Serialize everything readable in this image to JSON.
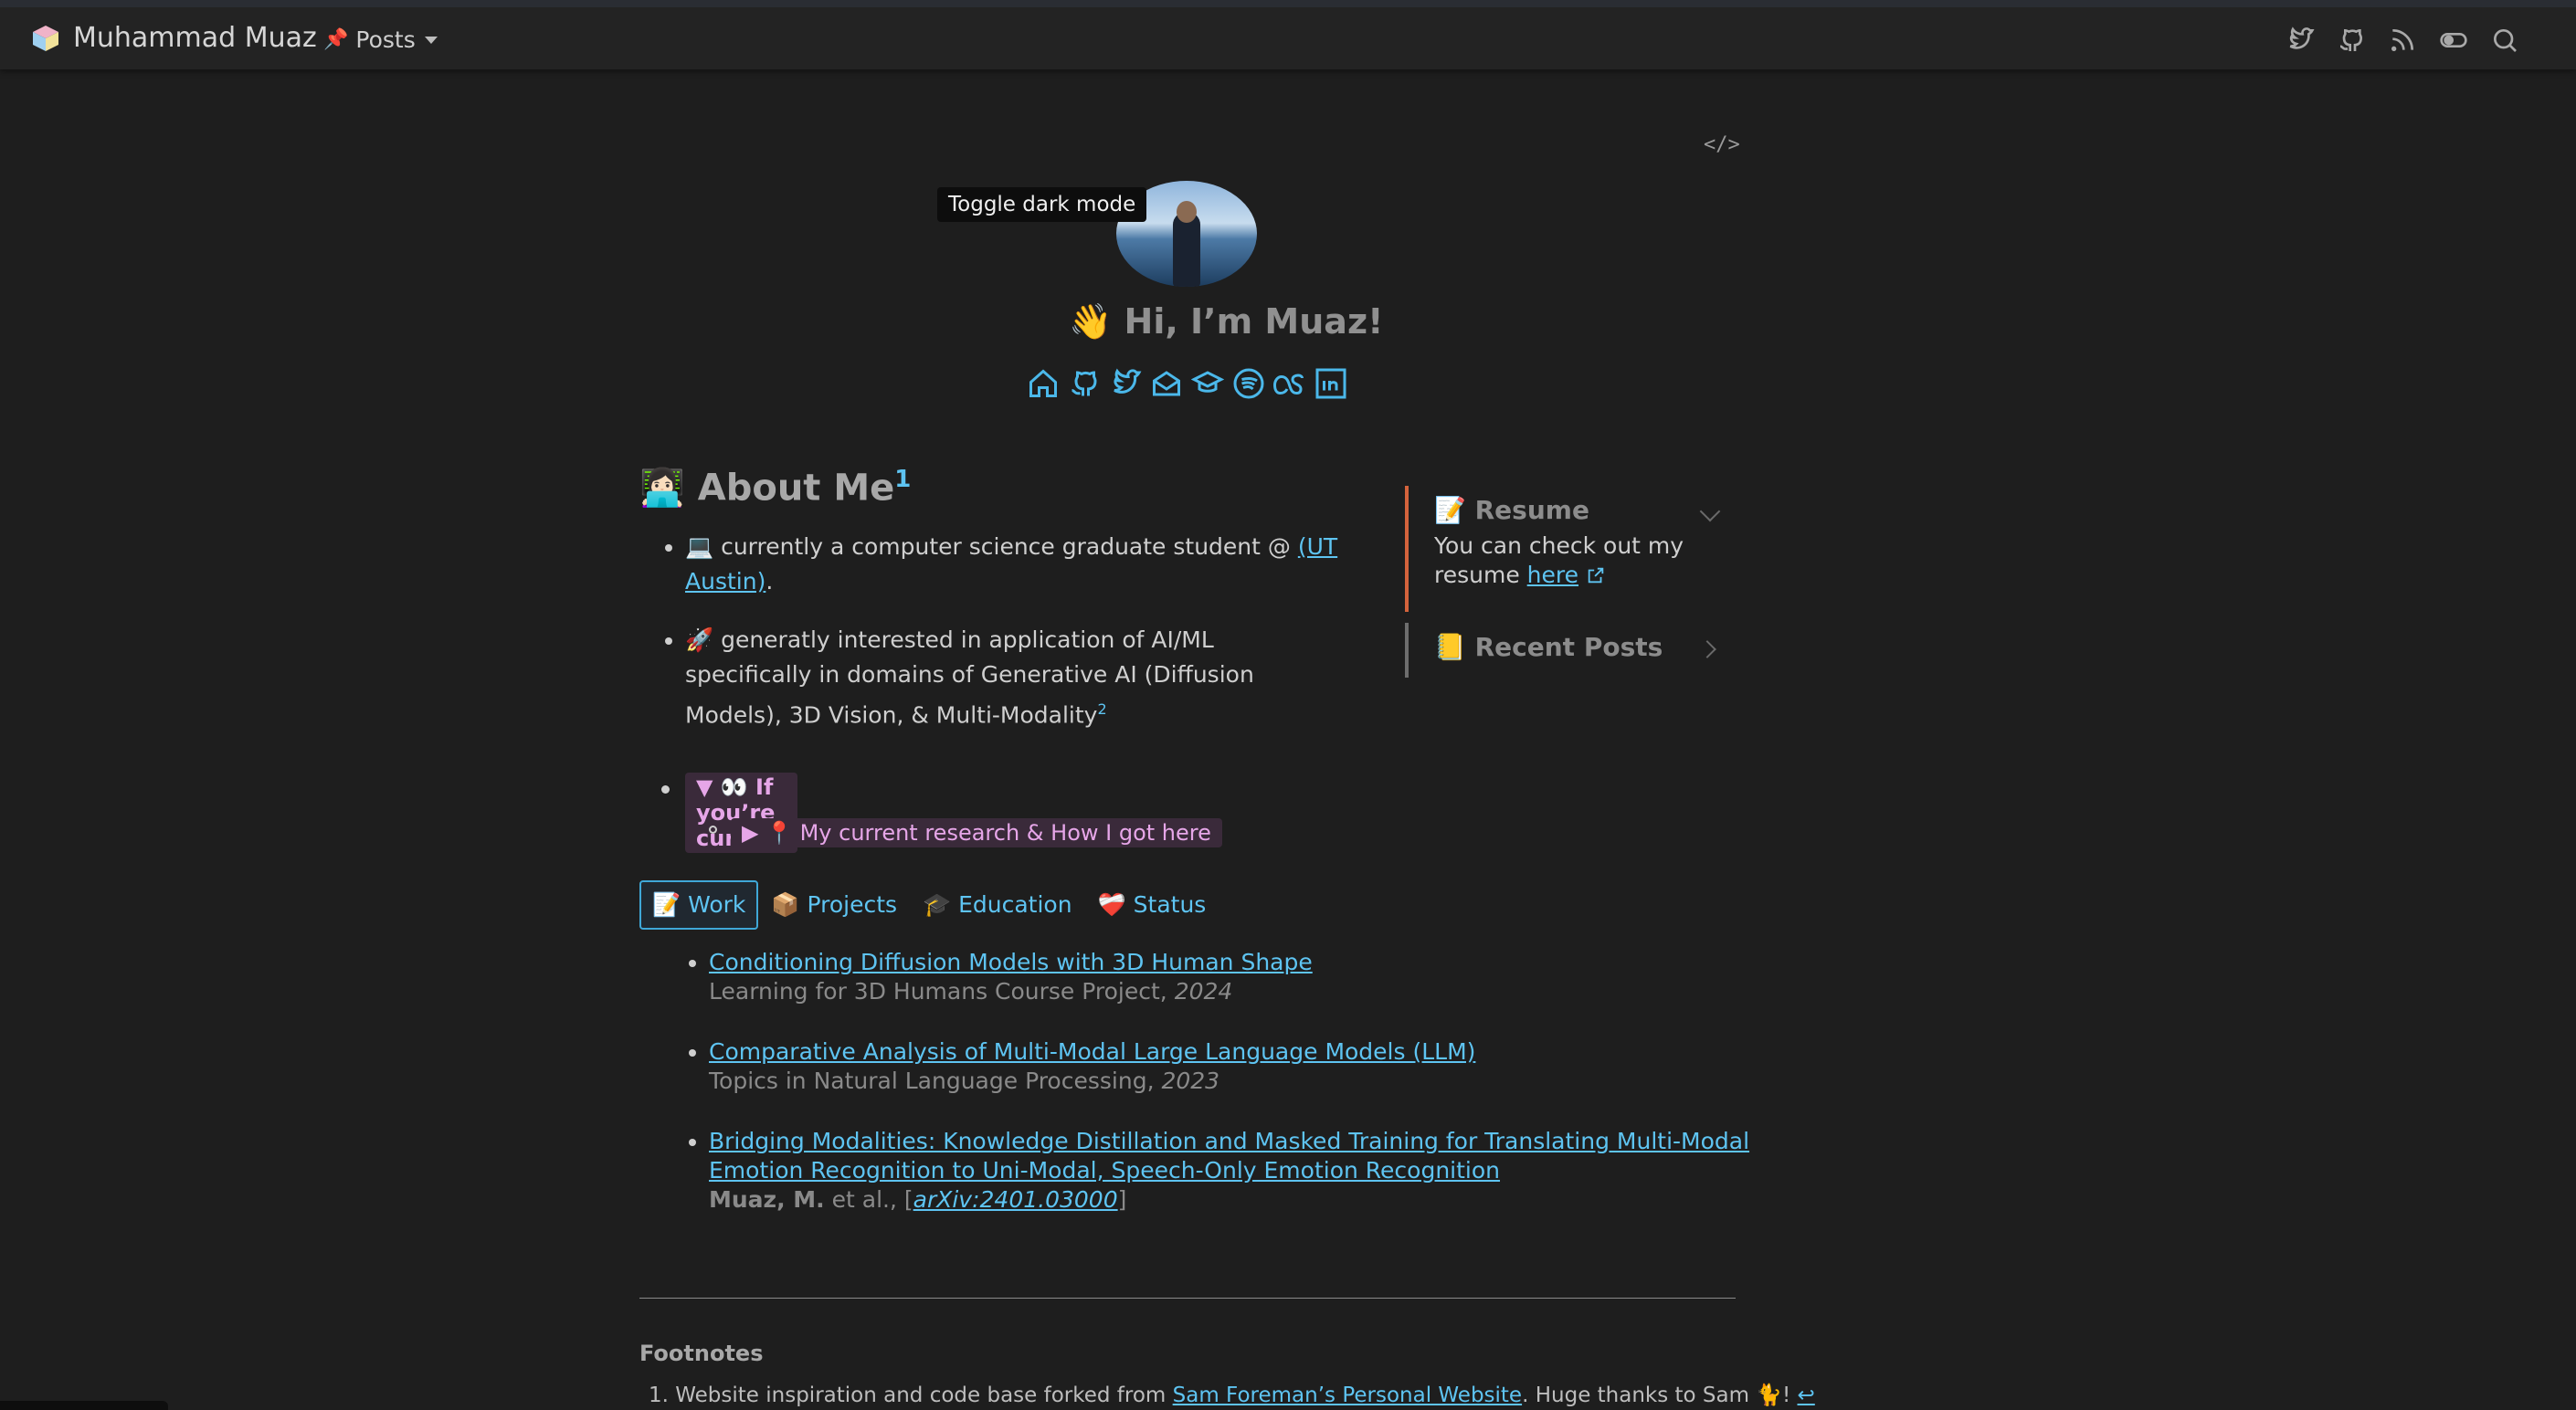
{
  "nav": {
    "brand_name": "Muhammad Muaz",
    "posts_label": "Posts",
    "posts_icon": "📌",
    "icons": [
      "twitter-icon",
      "github-icon",
      "rss-icon",
      "dark-mode-toggle-icon",
      "search-icon"
    ]
  },
  "header": {
    "code_icon": "</>",
    "tooltip": "Toggle dark mode",
    "greeting": "👋 Hi, I’m Muaz!"
  },
  "about": {
    "title_emoji": "👩🏻‍💻",
    "title": "About Me",
    "title_sup": "1",
    "item1_prefix": "💻 currently a computer science graduate student @ ",
    "item1_link": "(UT Austin)",
    "item1_suffix": ".",
    "item2_text": "🚀 generatly interested in application of AI/ML specifically in domains of Generative AI (Diffusion Models), 3D Vision, & Multi-Modality",
    "item2_sup": "2",
    "curious": "▼ 👀 If you’re curious",
    "research": "▶ 📍 My current research & How I got here"
  },
  "sidebar": {
    "resume_title": "📝 Resume",
    "resume_text": "You can check out my resume ",
    "resume_link": "here",
    "recent_title": "📒 Recent Posts"
  },
  "tabs": [
    {
      "label": "📝 Work"
    },
    {
      "label": "📦 Projects"
    },
    {
      "label": "🎓 Education"
    },
    {
      "label": "❤️‍🩹 Status"
    }
  ],
  "works": [
    {
      "title": "Conditioning Diffusion Models with 3D Human Shape",
      "sub": "Learning for 3D Humans Course Project, ",
      "year": "2024"
    },
    {
      "title": "Comparative Analysis of Multi-Modal Large Language Models (LLM)",
      "sub": "Topics in Natural Language Processing, ",
      "year": "2023"
    },
    {
      "title": "Bridging Modalities: Knowledge Distillation and Masked Training for Translating Multi-Modal Emotion Recognition to Uni-Modal, Speech-Only Emotion Recognition",
      "author": "Muaz, M.",
      "etal": " et al., [",
      "arxiv": "arXiv:2401.03000",
      "close": "]"
    }
  ],
  "footnotes": {
    "title": "Footnotes",
    "item1_prefix": "1. Website inspiration and code base forked from ",
    "item1_link": "Sam Foreman’s Personal Website",
    "item1_suffix": ". Huge thanks to Sam 🐈! ",
    "backref": "↩"
  }
}
